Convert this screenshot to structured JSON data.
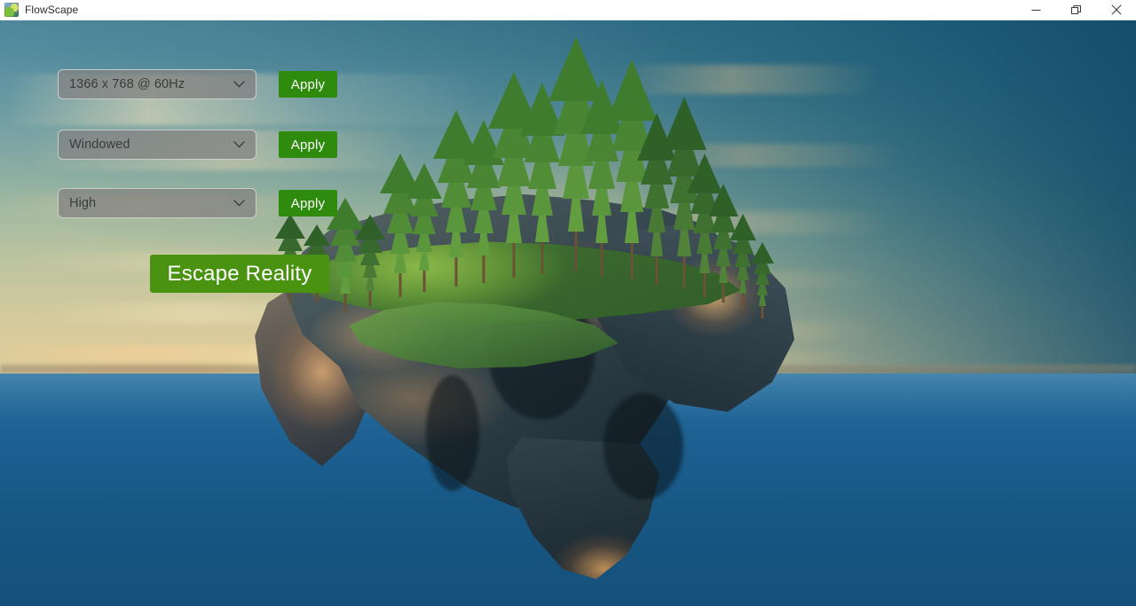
{
  "window": {
    "title": "FlowScape",
    "icon": "app-icon",
    "controls": [
      {
        "name": "minimize",
        "glyph": "minimize-icon"
      },
      {
        "name": "restore",
        "glyph": "restore-icon"
      },
      {
        "name": "close",
        "glyph": "close-icon"
      }
    ]
  },
  "colors": {
    "apply_green": "#2f8b0e",
    "escape_green": "#4a9311",
    "dropdown_fill": "#808080",
    "dropdown_border": "#dedede",
    "titlebar_bg": "#ffffff",
    "ocean_top": "#2b739f",
    "ocean_bottom": "#15507a",
    "sky_top": "#165470",
    "sun_glow": "#ffe59a"
  },
  "settings": {
    "rows": [
      {
        "id": "resolution",
        "value": "1366 x 768 @ 60Hz",
        "apply_label": "Apply",
        "chevron": "chevron-down-icon"
      },
      {
        "id": "window-mode",
        "value": "Windowed",
        "apply_label": "Apply",
        "chevron": "chevron-down-icon"
      },
      {
        "id": "quality",
        "value": "High",
        "apply_label": "Apply",
        "chevron": "chevron-down-icon"
      }
    ]
  },
  "launch": {
    "label": "Escape Reality"
  },
  "scene": {
    "description": "floating island with pine trees over ocean at sunset"
  }
}
